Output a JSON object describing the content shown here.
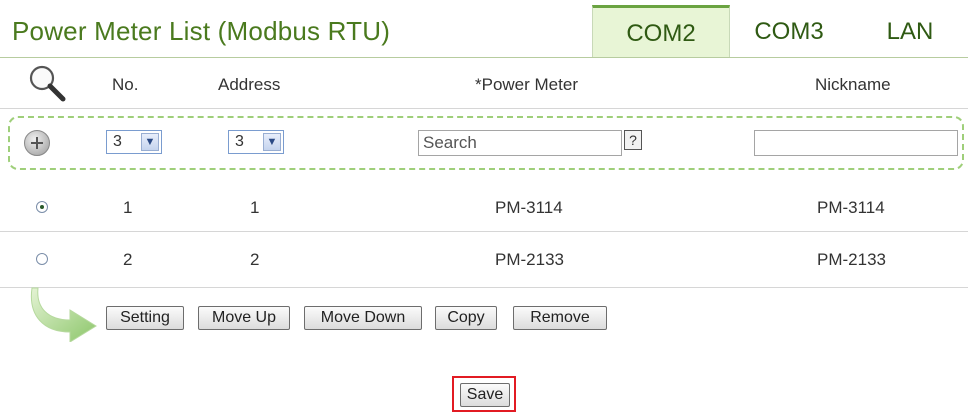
{
  "title": "Power Meter List (Modbus RTU)",
  "tabs": [
    {
      "label": "COM2",
      "active": true
    },
    {
      "label": "COM3",
      "active": false
    },
    {
      "label": "LAN",
      "active": false
    }
  ],
  "columns": {
    "no": "No.",
    "address": "Address",
    "power_meter": "*Power Meter",
    "nickname": "Nickname"
  },
  "search_row": {
    "no_select": "3",
    "address_select": "3",
    "search_placeholder": "Search",
    "help_label": "?",
    "nickname_value": ""
  },
  "rows": [
    {
      "selected": true,
      "no": "1",
      "address": "1",
      "power_meter": "PM-3114",
      "nickname": "PM-3114"
    },
    {
      "selected": false,
      "no": "2",
      "address": "2",
      "power_meter": "PM-2133",
      "nickname": "PM-2133"
    }
  ],
  "actions": {
    "setting": "Setting",
    "move_up": "Move Up",
    "move_down": "Move Down",
    "copy": "Copy",
    "remove": "Remove"
  },
  "save_label": "Save",
  "colors": {
    "accent_green": "#4a7a1e",
    "active_tab_bg": "#e8f5d6",
    "highlight_red": "#e21b23"
  },
  "icons": {
    "search": "magnifier-icon",
    "add": "plus-circle-icon",
    "arrow": "curved-arrow-icon",
    "dropdown": "chevron-down-icon"
  }
}
